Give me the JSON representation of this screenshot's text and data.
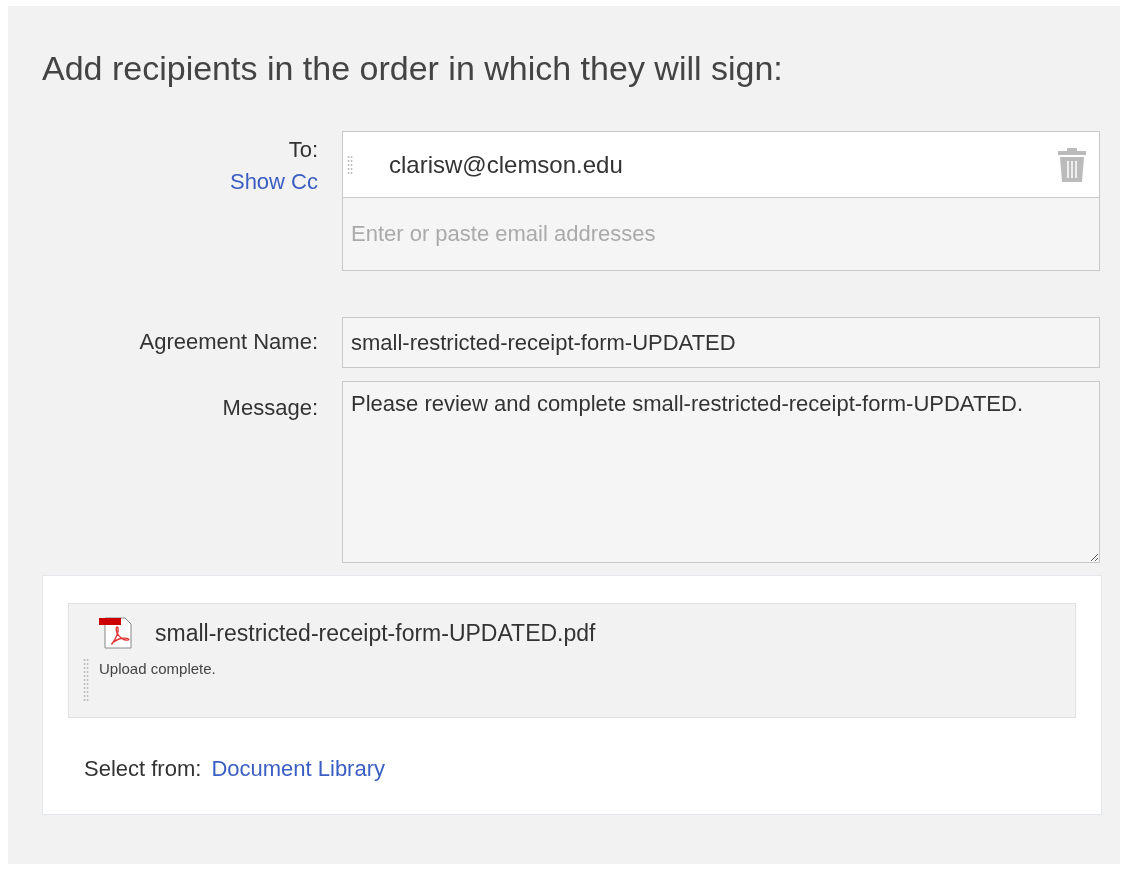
{
  "heading": "Add recipients in the order in which they will sign:",
  "recipients": {
    "label": "To:",
    "show_cc": "Show Cc",
    "entries": [
      "clarisw@clemson.edu"
    ],
    "placeholder": "Enter or paste email addresses"
  },
  "agreement_name": {
    "label": "Agreement Name:",
    "value": "small-restricted-receipt-form-UPDATED"
  },
  "message": {
    "label": "Message:",
    "value": "Please review and complete small-restricted-receipt-form-UPDATED."
  },
  "upload": {
    "file_name": "small-restricted-receipt-form-UPDATED.pdf",
    "status": "Upload complete.",
    "select_from_label": "Select from:",
    "library_link": "Document Library"
  }
}
